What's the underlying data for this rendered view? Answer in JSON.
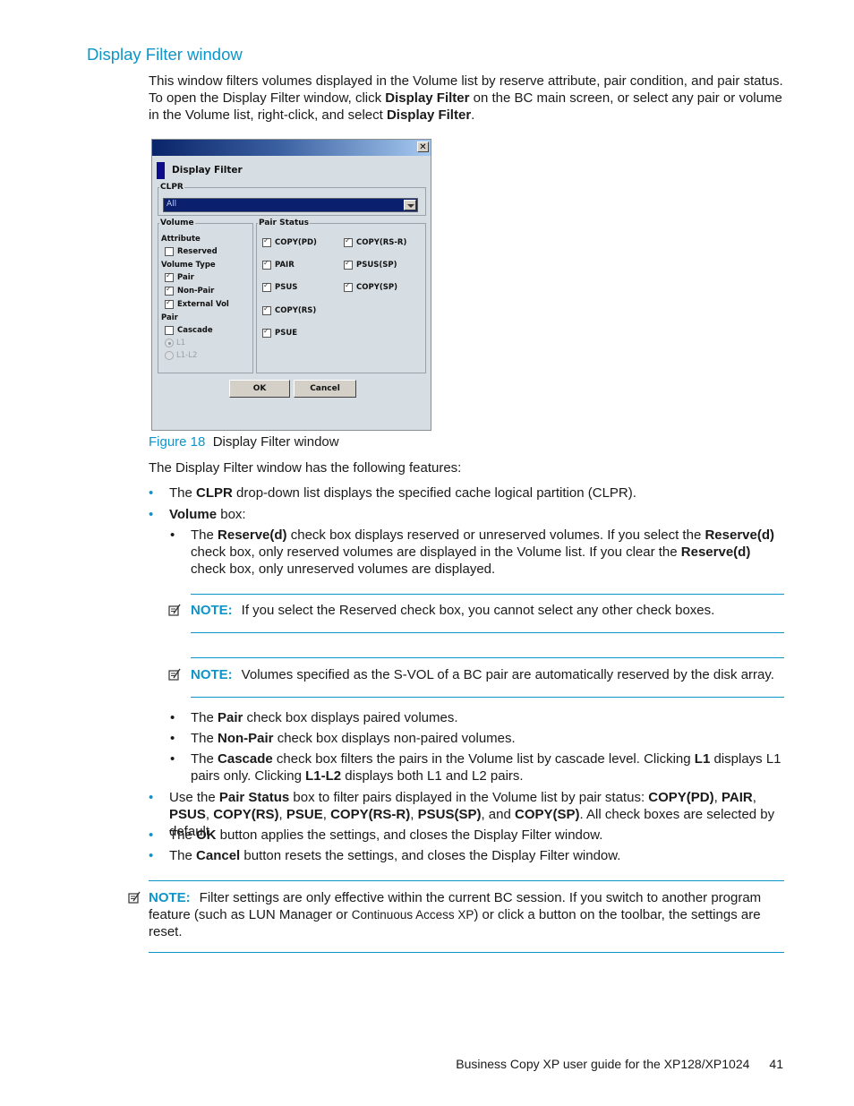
{
  "heading": "Display Filter window",
  "intro": {
    "t1": "This window filters volumes displayed in the Volume list by reserve attribute, pair condition, and pair status. To open the Display Filter window, click ",
    "b1": "Display Filter",
    "t2": " on the BC main screen, or select any pair or volume in the Volume list, right-click, and select ",
    "b2": "Display Filter",
    "t3": "."
  },
  "window": {
    "close_glyph": "✕",
    "title": "Display Filter",
    "clpr": {
      "legend": "CLPR",
      "selected": "All"
    },
    "volume": {
      "legend": "Volume",
      "attribute_label": "Attribute",
      "reserved": {
        "label": "Reserved",
        "checked": false
      },
      "volume_type_label": "Volume Type",
      "pair": {
        "label": "Pair",
        "checked": true
      },
      "non_pair": {
        "label": "Non-Pair",
        "checked": true
      },
      "external_vol": {
        "label": "External Vol",
        "checked": true
      },
      "pair_label": "Pair",
      "cascade": {
        "label": "Cascade",
        "checked": false
      },
      "l1": {
        "label": "L1",
        "selected": true,
        "enabled": false
      },
      "l1_l2": {
        "label": "L1-L2",
        "selected": false,
        "enabled": false
      }
    },
    "pair_status": {
      "legend": "Pair Status",
      "items": [
        {
          "label": "COPY(PD)",
          "checked": true
        },
        {
          "label": "COPY(RS-R)",
          "checked": true
        },
        {
          "label": "PAIR",
          "checked": true
        },
        {
          "label": "PSUS(SP)",
          "checked": true
        },
        {
          "label": "PSUS",
          "checked": true
        },
        {
          "label": "COPY(SP)",
          "checked": true
        },
        {
          "label": "COPY(RS)",
          "checked": true
        },
        {
          "label": "PSUE",
          "checked": true
        }
      ]
    },
    "ok_label": "OK",
    "cancel_label": "Cancel"
  },
  "caption": {
    "fig": "Figure 18",
    "text": "Display Filter window"
  },
  "features_intro": "The Display Filter window has the following features:",
  "bullets": {
    "clpr": {
      "t1": "The ",
      "b1": "CLPR",
      "t2": " drop-down list displays the specified cache logical partition (CLPR)."
    },
    "volume": {
      "b1": "Volume",
      "t1": " box:"
    },
    "reserve": {
      "t1": "The ",
      "b1": "Reserve(d)",
      "t2": " check box displays reserved or unreserved volumes. If you select the ",
      "b2": "Reserve(d)",
      "t3": " check box, only reserved volumes are displayed in the Volume list. If you clear the ",
      "b3": "Reserve(d)",
      "t4": " check box, only unreserved volumes are displayed."
    },
    "pair": {
      "t1": "The ",
      "b1": "Pair",
      "t2": " check box displays paired volumes."
    },
    "nonpair": {
      "t1": "The ",
      "b1": "Non-Pair",
      "t2": " check box displays non-paired volumes."
    },
    "cascade": {
      "t1": "The ",
      "b1": "Cascade",
      "t2": " check box filters the pairs in the Volume list by cascade level. Clicking ",
      "b2": "L1",
      "t3": " displays L1 pairs only. Clicking ",
      "b3": "L1-L2",
      "t4": " displays both L1 and L2 pairs."
    },
    "pairstatus": {
      "t1": "Use the ",
      "b1": "Pair Status",
      "t2": " box to filter pairs displayed in the Volume list by pair status: ",
      "b2": "COPY(PD)",
      "s1": ", ",
      "b3": "PAIR",
      "s2": ", ",
      "b4": "PSUS",
      "s3": ", ",
      "b5": "COPY(RS)",
      "s4": ", ",
      "b6": "PSUE",
      "s5": ", ",
      "b7": "COPY(RS-R)",
      "s6": ", ",
      "b8": "PSUS(SP)",
      "s7": ", and ",
      "b9": "COPY(SP)",
      "t3": ". All check boxes are selected by default."
    },
    "ok": {
      "t1": "The ",
      "b1": "OK",
      "t2": " button applies the settings, and closes the Display Filter window."
    },
    "cancel": {
      "t1": "The ",
      "b1": "Cancel",
      "t2": " button resets the settings, and closes the Display Filter window."
    }
  },
  "notes": {
    "label": "NOTE:",
    "n1": "If you select the Reserved check box, you cannot select any other check boxes.",
    "n2": "Volumes specified as the S-VOL of a BC pair are automatically reserved by the disk array.",
    "n3a": "Filter settings are only effective within the current BC session. If you switch to another program feature (such as LUN Manager or ",
    "n3b": "Continuous Access XP",
    "n3c": ") or click a button on the toolbar, the settings are reset."
  },
  "footer": {
    "title": "Business Copy XP user guide for the XP128/XP1024",
    "page": "41"
  }
}
